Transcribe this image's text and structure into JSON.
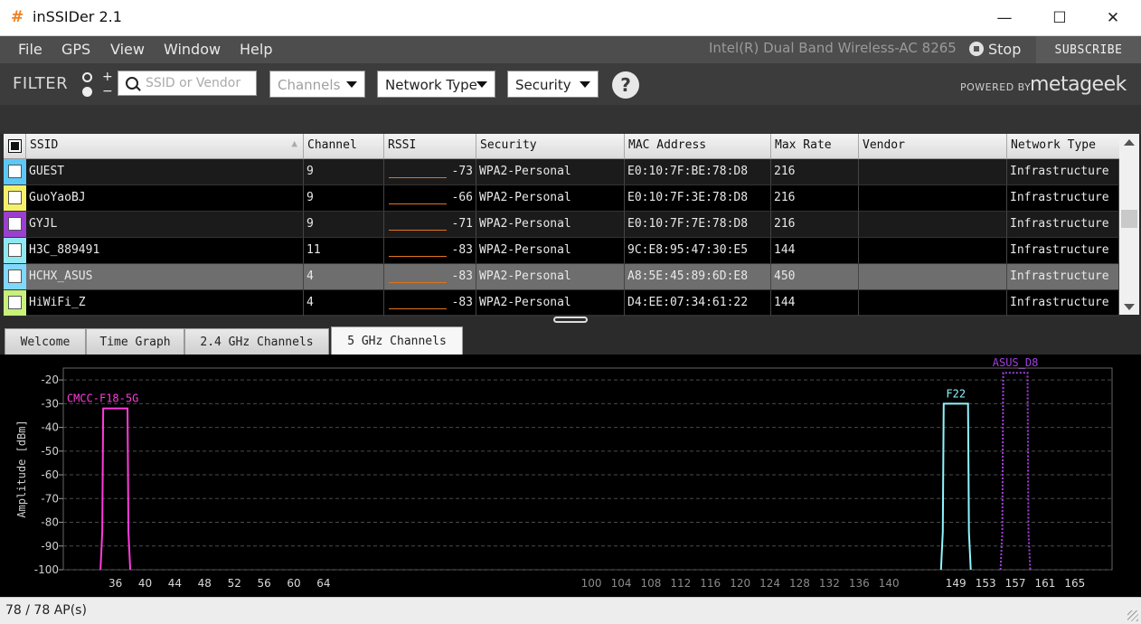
{
  "window": {
    "title": "inSSIDer 2.1",
    "icon": "hash-icon",
    "minimize": "—",
    "maximize": "☐",
    "close": "✕"
  },
  "menu": {
    "items": [
      "File",
      "GPS",
      "View",
      "Window",
      "Help"
    ],
    "adapter": "Intel(R) Dual Band Wireless-AC 8265",
    "stop_label": "Stop",
    "subscribe_label": "SUBSCRIBE"
  },
  "filter": {
    "label": "FILTER",
    "toggle_plus": "+",
    "toggle_minus": "−",
    "search_placeholder": "SSID or Vendor",
    "channels": "Channels",
    "network_type": "Network Type",
    "security": "Security",
    "help": "?",
    "powered_by": "POWERED BY",
    "brand": "metageek"
  },
  "table": {
    "columns": [
      "SSID",
      "Channel",
      "RSSI",
      "Security",
      "MAC Address",
      "Max Rate",
      "Vendor",
      "Network Type"
    ],
    "rows": [
      {
        "color": "#5bc8f5",
        "ssid": "GUEST",
        "channel": "9",
        "rssi": "-73",
        "security": "WPA2-Personal",
        "mac": "E0:10:7F:BE:78:D8",
        "max_rate": "216",
        "vendor": "",
        "network_type": "Infrastructure"
      },
      {
        "color": "#f5f06a",
        "ssid": "GuoYaoBJ",
        "channel": "9",
        "rssi": "-66",
        "security": "WPA2-Personal",
        "mac": "E0:10:7F:3E:78:D8",
        "max_rate": "216",
        "vendor": "",
        "network_type": "Infrastructure"
      },
      {
        "color": "#9b3fd1",
        "ssid": "GYJL",
        "channel": "9",
        "rssi": "-71",
        "security": "WPA2-Personal",
        "mac": "E0:10:7F:7E:78:D8",
        "max_rate": "216",
        "vendor": "",
        "network_type": "Infrastructure"
      },
      {
        "color": "#8fe8f0",
        "ssid": "H3C_889491",
        "channel": "11",
        "rssi": "-83",
        "security": "WPA2-Personal",
        "mac": "9C:E8:95:47:30:E5",
        "max_rate": "144",
        "vendor": "",
        "network_type": "Infrastructure"
      },
      {
        "color": "#7fd8ff",
        "ssid": "HCHX_ASUS",
        "channel": "4",
        "rssi": "-83",
        "security": "WPA2-Personal",
        "mac": "A8:5E:45:89:6D:E8",
        "max_rate": "450",
        "vendor": "",
        "network_type": "Infrastructure"
      },
      {
        "color": "#c8f07a",
        "ssid": "HiWiFi_Z",
        "channel": "4",
        "rssi": "-83",
        "security": "WPA2-Personal",
        "mac": "D4:EE:07:34:61:22",
        "max_rate": "144",
        "vendor": "",
        "network_type": "Infrastructure"
      }
    ]
  },
  "tabs": [
    "Welcome",
    "Time Graph",
    "2.4 GHz Channels",
    "5 GHz Channels"
  ],
  "chart_data": {
    "type": "line",
    "ylabel": "Amplitude [dBm]",
    "ylim": [
      -100,
      -15
    ],
    "yticks": [
      -20,
      -30,
      -40,
      -50,
      -60,
      -70,
      -80,
      -90,
      -100
    ],
    "xlim": [
      29,
      170
    ],
    "x_ticks_low_band": [
      36,
      40,
      44,
      48,
      52,
      56,
      60,
      64
    ],
    "x_ticks_mid_band": [
      100,
      104,
      108,
      112,
      116,
      120,
      124,
      128,
      132,
      136,
      140
    ],
    "x_ticks_high_band": [
      149,
      153,
      157,
      161,
      165
    ],
    "grid": true,
    "series": [
      {
        "name": "CMCC-F18-5G",
        "channel_start": 34,
        "channel_end": 38,
        "amplitude": -32,
        "color": "#ff3cdc",
        "style": "solid"
      },
      {
        "name": "F22",
        "channel_start": 147,
        "channel_end": 151,
        "amplitude": -30,
        "color": "#8ff5ff",
        "style": "solid"
      },
      {
        "name": "ASUS_D8",
        "channel_start": 155,
        "channel_end": 159,
        "amplitude": -17,
        "color": "#a33fe0",
        "style": "dotted"
      }
    ]
  },
  "status": {
    "ap_count": "78 / 78 AP(s)"
  }
}
